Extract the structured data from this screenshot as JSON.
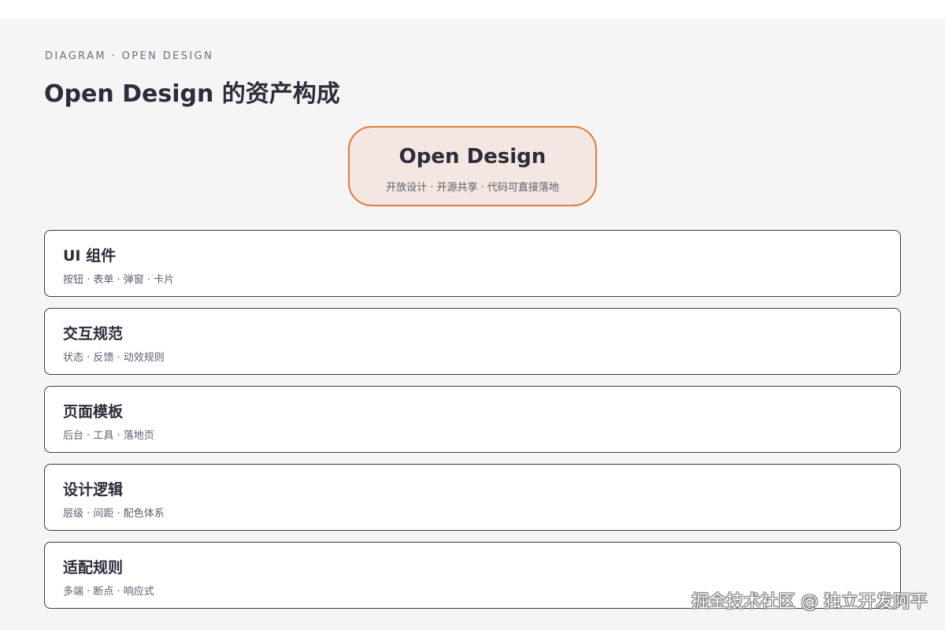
{
  "header": {
    "eyebrow": "DIAGRAM · OPEN DESIGN",
    "title": "Open Design 的资产构成"
  },
  "root": {
    "title": "Open Design",
    "subtitle": "开放设计 · 开源共享 · 代码可直接落地"
  },
  "items": [
    {
      "title": "UI 组件",
      "subtitle": "按钮 · 表单 · 弹窗 · 卡片"
    },
    {
      "title": "交互规范",
      "subtitle": "状态 · 反馈 · 动效规则"
    },
    {
      "title": "页面模板",
      "subtitle": "后台 · 工具 · 落地页"
    },
    {
      "title": "设计逻辑",
      "subtitle": "层级 · 间距 · 配色体系"
    },
    {
      "title": "适配规则",
      "subtitle": "多端 · 断点 · 响应式"
    }
  ],
  "watermark": "掘金技术社区 @ 独立开发阿平",
  "colors": {
    "accent": "#e07b3e",
    "root_fill": "#f4e6e0",
    "background": "#f5f5f6",
    "card_border": "#3a3c48"
  }
}
